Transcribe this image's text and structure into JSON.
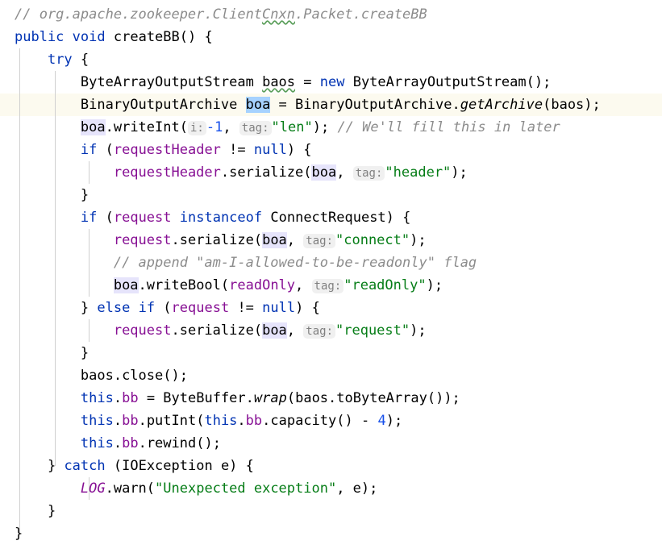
{
  "editor": {
    "language": "Java",
    "theme": "IntelliJ Light",
    "font_size_px": 17,
    "line_height_px": 28,
    "colors": {
      "background": "#ffffff",
      "keyword": "#0033b3",
      "plain_text": "#000000",
      "field": "#871094",
      "number": "#1750eb",
      "string": "#067d17",
      "comment": "#8c8c8c",
      "caret_row": "#fcfaef",
      "occurrence_highlight": "#e6e4fb",
      "selection_highlight": "#a6d2ff",
      "inlay_hint_background": "#f0f0f0",
      "inlay_hint_text": "#808080",
      "indent_guide": "#d0d0d0",
      "typo_squiggle": "#5a9e5a"
    },
    "caret_line_number": 5
  },
  "code": {
    "line_01": {
      "comment": "// org.apache.zookeeper.ClientCnxn.Packet.createBB",
      "comment_head": "// org.apache.zookeeper.Client",
      "typo_word": "Cnxn",
      "comment_tail": ".Packet.createBB"
    },
    "line_02": {
      "kw_public": "public",
      "kw_void": "void",
      "method": "createBB",
      "parens": "() {"
    },
    "line_03": {
      "kw_try": "try",
      "brace": " {"
    },
    "line_04": {
      "type": "ByteArrayOutputStream",
      "var": "baos",
      "eq": " = ",
      "kw_new": "new",
      "ctor": " ByteArrayOutputStream();"
    },
    "line_05": {
      "type": "BinaryOutputArchive ",
      "var_selected": "boa",
      "eq": " = ",
      "class": "BinaryOutputArchive",
      "dot": ".",
      "static_method": "getArchive",
      "args": "(baos);"
    },
    "line_06": {
      "var": "boa",
      "call": ".writeInt(",
      "hint_i": "i:",
      "num": "-1",
      "comma": ", ",
      "hint_tag": "tag:",
      "str": "\"len\"",
      "close": ");",
      "comment": "// We'll fill this in later"
    },
    "line_07": {
      "kw_if": "if",
      "open": " (",
      "field": "requestHeader",
      "ne": " != ",
      "kw_null": "null",
      "close": ") {"
    },
    "line_08": {
      "field": "requestHeader",
      "call": ".serialize(",
      "var": "boa",
      "comma": ", ",
      "hint_tag": "tag:",
      "str": "\"header\"",
      "close": ");"
    },
    "line_09": {
      "brace": "}"
    },
    "line_10": {
      "kw_if": "if",
      "open": " (",
      "field": "request",
      "kw_instanceof": "instanceof",
      "type": "ConnectRequest",
      "close": ") {"
    },
    "line_11": {
      "field": "request",
      "call": ".serialize(",
      "var": "boa",
      "comma": ", ",
      "hint_tag": "tag:",
      "str": "\"connect\"",
      "close": ");"
    },
    "line_12": {
      "comment": "// append \"am-I-allowed-to-be-readonly\" flag"
    },
    "line_13": {
      "var": "boa",
      "call": ".writeBool(",
      "field": "readOnly",
      "comma": ", ",
      "hint_tag": "tag:",
      "str": "\"readOnly\"",
      "close": ");"
    },
    "line_14": {
      "brace": "} ",
      "kw_else": "else",
      "kw_if": "if",
      "open": " (",
      "field": "request",
      "ne": " != ",
      "kw_null": "null",
      "close": ") {"
    },
    "line_15": {
      "field": "request",
      "call": ".serialize(",
      "var": "boa",
      "comma": ", ",
      "hint_tag": "tag:",
      "str": "\"request\"",
      "close": ");"
    },
    "line_16": {
      "brace": "}"
    },
    "line_17": {
      "text": "baos.close();"
    },
    "line_18": {
      "kw_this": "this",
      "dot": ".",
      "field": "bb",
      "eq": " = ",
      "class": "ByteBuffer",
      "dot2": ".",
      "static_method": "wrap",
      "args": "(baos.toByteArray());"
    },
    "line_19": {
      "kw_this": "this",
      "dot": ".",
      "field": "bb",
      "call": ".putInt(",
      "kw_this2": "this",
      "dot2": ".",
      "field2": "bb",
      "call2": ".capacity() - ",
      "num": "4",
      "close": ");"
    },
    "line_20": {
      "kw_this": "this",
      "dot": ".",
      "field": "bb",
      "call": ".rewind();"
    },
    "line_21": {
      "brace": "} ",
      "kw_catch": "catch",
      "open": " (",
      "type": "IOException",
      "param": " e) {"
    },
    "line_22": {
      "static_field": "LOG",
      "call": ".warn(",
      "str": "\"Unexpected exception\"",
      "args": ", e);"
    },
    "line_23": {
      "brace": "}"
    },
    "line_24": {
      "brace": "}"
    },
    "line_25": {
      "brace": "}"
    }
  }
}
